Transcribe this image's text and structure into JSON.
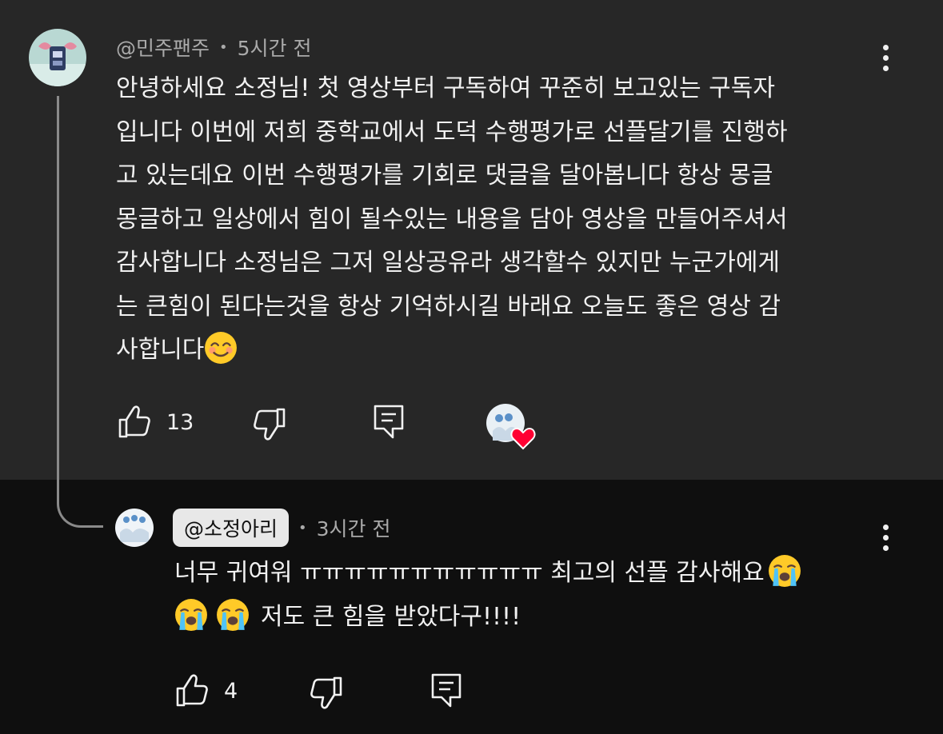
{
  "comment": {
    "author": "@민주팬주",
    "time": "5시간 전",
    "text_lines": [
      "안녕하세요 소정님! 첫 영상부터 구독하여 꾸준히 보고있는 구독자",
      "입니다 이번에 저희 중학교에서 도덕 수행평가로 선플달기를 진행하",
      "고 있는데요 이번 수행평가를 기회로 댓글을 달아봅니다 항상 몽글",
      "몽글하고 일상에서 힘이 될수있는 내용을 담아 영상을 만들어주셔서",
      "감사합니다 소정님은 그저 일상공유라 생각할수 있지만 누군가에게",
      "는 큰힘이 된다는것을 항상 기억하시길 바래요 오늘도 좋은 영상 감",
      "사합니다"
    ],
    "like_count": "13",
    "icons": [
      "thumbs-up-icon",
      "thumbs-down-icon",
      "reply-icon",
      "creator-heart-icon",
      "more-icon",
      "smile-emoji"
    ]
  },
  "reply": {
    "author": "@소정아리",
    "time": "3시간 전",
    "line1_text": "너무 귀여워 ㅠㅠㅠㅠㅠㅠㅠㅠㅠㅠㅠ 최고의 선플 감사해요",
    "line2_text": "저도 큰 힘을 받았다구!!!!",
    "like_count": "4",
    "icons": [
      "thumbs-up-icon",
      "thumbs-down-icon",
      "reply-icon",
      "more-icon",
      "crying-emoji"
    ]
  },
  "colors": {
    "top_bg": "#272727",
    "bottom_bg": "#0f0f0f",
    "text": "#f1f1f1",
    "meta": "#aaaaaa",
    "heart": "#ff0033"
  }
}
